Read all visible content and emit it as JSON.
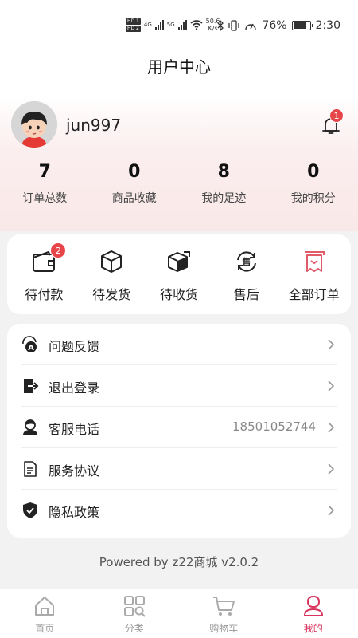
{
  "status_bar": {
    "sim1": "HD 1",
    "sim2": "HD 2",
    "net1": "4G",
    "net2": "5G",
    "speed_value": "50.6",
    "speed_unit": "K/s",
    "battery": "76%",
    "time": "2:30"
  },
  "header": {
    "title": "用户中心"
  },
  "profile": {
    "username": "jun997",
    "notification_count": "1"
  },
  "stats": [
    {
      "value": "7",
      "label": "订单总数"
    },
    {
      "value": "0",
      "label": "商品收藏"
    },
    {
      "value": "8",
      "label": "我的足迹"
    },
    {
      "value": "0",
      "label": "我的积分"
    }
  ],
  "orders": [
    {
      "label": "待付款",
      "icon": "wallet-icon",
      "badge": "2"
    },
    {
      "label": "待发货",
      "icon": "package-icon"
    },
    {
      "label": "待收货",
      "icon": "delivery-box-icon"
    },
    {
      "label": "售后",
      "icon": "after-sales-icon"
    },
    {
      "label": "全部订单",
      "icon": "receipt-icon"
    }
  ],
  "menu": [
    {
      "label": "问题反馈",
      "icon": "feedback-icon"
    },
    {
      "label": "退出登录",
      "icon": "logout-icon"
    },
    {
      "label": "客服电话",
      "icon": "customer-service-icon",
      "value": "18501052744"
    },
    {
      "label": "服务协议",
      "icon": "document-icon"
    },
    {
      "label": "隐私政策",
      "icon": "shield-icon"
    }
  ],
  "footer": {
    "powered_by": "Powered by z22商城 v2.0.2"
  },
  "tabs": [
    {
      "label": "首页",
      "icon": "home-icon"
    },
    {
      "label": "分类",
      "icon": "category-icon"
    },
    {
      "label": "购物车",
      "icon": "cart-icon"
    },
    {
      "label": "我的",
      "icon": "user-icon",
      "active": true
    }
  ],
  "colors": {
    "accent": "#d8345f",
    "badge": "#e6464a",
    "receipt_icon": "#e05a6a"
  }
}
